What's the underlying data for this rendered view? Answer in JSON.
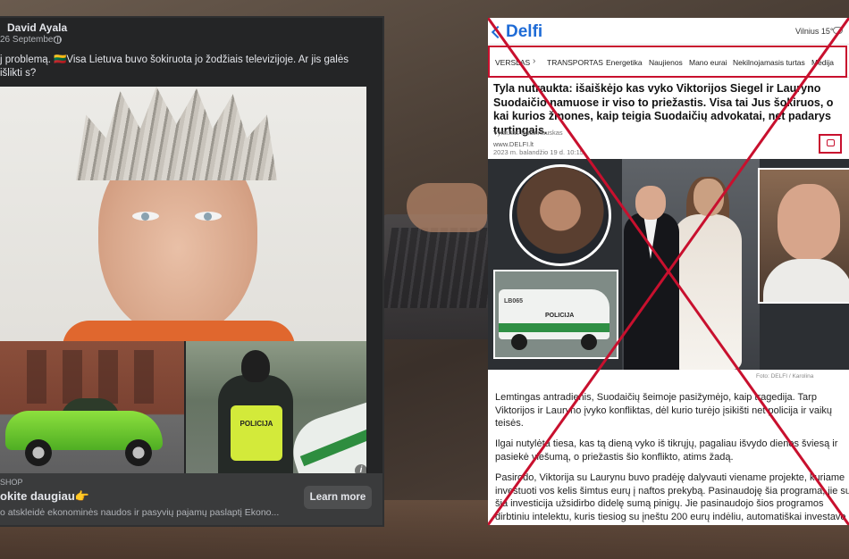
{
  "facebook_ad": {
    "author": "David Ayala",
    "date": "26 September ·",
    "post_text": "j problemą. 🇱🇹Visa Lietuva buvo šokiruota jo žodžiais televizijoje. Ar jis galės išlikti s?",
    "police_vest_text": "POLICIJA",
    "shop_label": "SHOP",
    "headline": "okite daugiau👉",
    "description": "o atskleidė ekonominės naudos ir pasyvių pajamų paslaptį Ekono...",
    "cta_label": "Learn more",
    "icons": [
      "globe-icon",
      "info-icon"
    ]
  },
  "delfi": {
    "logo": "Delfi",
    "weather": "Vilnius 15°",
    "nav": [
      {
        "label": "VERSLAS"
      },
      {
        "label": "TRANSPORTAS"
      },
      {
        "label": "Energetika"
      },
      {
        "label": "Naujienos"
      },
      {
        "label": "Mano eurai"
      },
      {
        "label": "Nekilnojamasis turtas"
      },
      {
        "label": "Medija"
      }
    ],
    "title": "Tyla nutraukta: išaiškėjo kas vyko Viktorijos Siegel ir Lauryno Suodaičio namuose ir viso to priežastis. Visa tai Jus šokiruos, o kai kurios žmones, kaip teigia Suodaičių advokatai, net padarys turtingais.",
    "author": "Vytautas Budzinauskas",
    "source": "www.DELFI.lt",
    "date": "2023 m. balandžio 19 d. 10:15",
    "van_label": "POLICIJA",
    "van_plate": "LB065",
    "photo_caption": "Foto: DELFI / Karolina",
    "paragraphs": [
      "Lemtingas antradienis, Suodaičių šeimoje pasižymėjo, kaip tragedija. Tarp Viktorijos ir Lauryno įvyko konfliktas, dėl kurio turėjo įsikišti net policija ir vaikų teisės.",
      "Ilgai nutylėta tiesa, kas tą dieną vyko iš tikrųjų, pagaliau išvydo dienos šviesą ir pasiekė viešumą, o priežastis šio konflikto, atims žadą.",
      "Pasirodo, Viktorija su Laurynu buvo pradėję dalyvauti viename projekte, kuriame investuoti vos kelis šimtus eurų į naftos prekybą. Pasinaudoję šia programa, jie su šia investicija užsidirbo didelę sumą pinigų. Jie pasinaudojo šios programos dirbtiniu intelektu, kuris tiesiog su įneštu 200 eurų indėliu, automatiškai investavo naftos biržoje."
    ],
    "icons": [
      "weather-icon",
      "comment-icon",
      "chevron-right-icon"
    ]
  },
  "colors": {
    "cross_red": "#c8102e",
    "delfi_blue": "#1e6bd6",
    "fb_dark": "#242526"
  }
}
